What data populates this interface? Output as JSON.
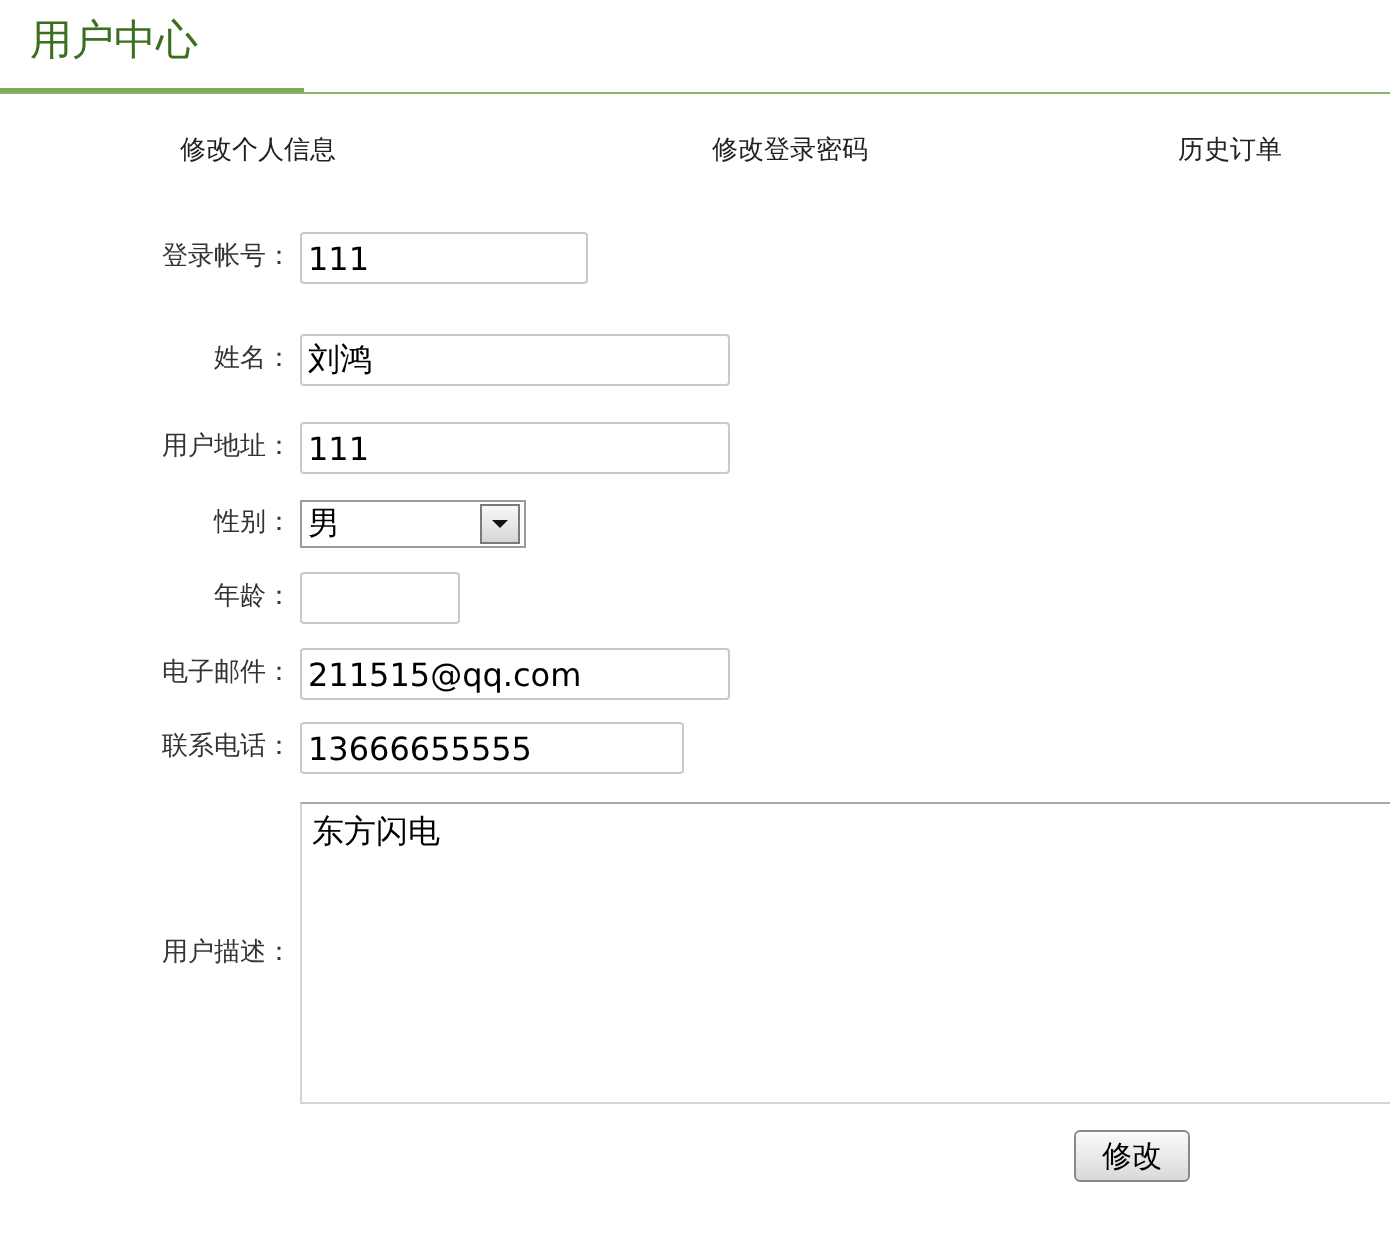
{
  "header": {
    "title": "用户中心"
  },
  "tabs": [
    {
      "label": "修改个人信息"
    },
    {
      "label": "修改登录密码"
    },
    {
      "label": "历史订单"
    }
  ],
  "form": {
    "fields": [
      {
        "kind": "text",
        "label": "登录帐号：",
        "value": "111"
      },
      {
        "kind": "text",
        "label": "姓名：",
        "value": "刘鸿"
      },
      {
        "kind": "text",
        "label": "用户地址：",
        "value": "111"
      },
      {
        "kind": "select",
        "label": "性别：",
        "value": "男"
      },
      {
        "kind": "text",
        "label": "年龄："
      },
      {
        "kind": "text",
        "label": "电子邮件：",
        "value": "211515@qq.com"
      },
      {
        "kind": "text",
        "label": "联系电话：",
        "value": "13666655555"
      },
      {
        "kind": "textarea",
        "label": "用户描述：",
        "value": "东方闪电"
      }
    ],
    "submit": "修改"
  }
}
